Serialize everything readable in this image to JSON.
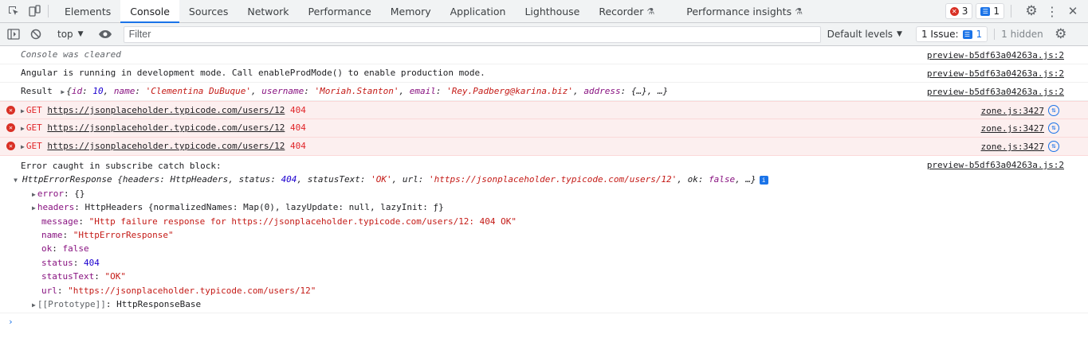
{
  "tabs": [
    "Elements",
    "Console",
    "Sources",
    "Network",
    "Performance",
    "Memory",
    "Application",
    "Lighthouse",
    "Recorder",
    "Performance insights"
  ],
  "active_tab": "Console",
  "badges": {
    "errors": "3",
    "messages": "1"
  },
  "toolbar": {
    "context": "top",
    "filter_placeholder": "Filter",
    "levels": "Default levels",
    "issues_label": "1 Issue:",
    "issues_count": "1",
    "hidden": "1 hidden"
  },
  "messages": {
    "cleared": "Console was cleared",
    "cleared_src": "preview-b5df63a04263a.js:2",
    "angular": "Angular is running in development mode. Call enableProdMode() to enable production mode.",
    "angular_src": "preview-b5df63a04263a.js:2",
    "result_label": "Result",
    "result_src": "preview-b5df63a04263a.js:2",
    "result_obj": {
      "id_key": "id",
      "id_val": "10",
      "name_key": "name",
      "name_val": "'Clementina DuBuque'",
      "username_key": "username",
      "username_val": "'Moriah.Stanton'",
      "email_key": "email",
      "email_val": "'Rey.Padberg@karina.biz'",
      "address_key": "address",
      "address_val": "{…}",
      "ellipsis": "…"
    },
    "errors": [
      {
        "method": "GET",
        "url": "https://jsonplaceholder.typicode.com/users/12",
        "code": "404",
        "src": "zone.js:3427"
      },
      {
        "method": "GET",
        "url": "https://jsonplaceholder.typicode.com/users/12",
        "code": "404",
        "src": "zone.js:3427"
      },
      {
        "method": "GET",
        "url": "https://jsonplaceholder.typicode.com/users/12",
        "code": "404",
        "src": "zone.js:3427"
      }
    ],
    "caught": "Error caught in subscribe catch block:",
    "caught_src": "preview-b5df63a04263a.js:2",
    "http_error": {
      "summary_name": "HttpErrorResponse",
      "summary_headers_key": "headers",
      "summary_headers_val": "HttpHeaders",
      "summary_status_key": "status",
      "summary_status_val": "404",
      "summary_statusText_key": "statusText",
      "summary_statusText_val": "'OK'",
      "summary_url_key": "url",
      "summary_url_val": "'https://jsonplaceholder.typicode.com/users/12'",
      "summary_ok_key": "ok",
      "summary_ok_val": "false",
      "error_key": "error",
      "error_val": "{}",
      "headers_key": "headers",
      "headers_val": "HttpHeaders {normalizedNames: Map(0), lazyUpdate: null, lazyInit: ƒ}",
      "message_key": "message",
      "message_val": "\"Http failure response for https://jsonplaceholder.typicode.com/users/12: 404 OK\"",
      "name_key": "name",
      "name_val": "\"HttpErrorResponse\"",
      "ok_key": "ok",
      "ok_val": "false",
      "status_key": "status",
      "status_val": "404",
      "statusText_key": "statusText",
      "statusText_val": "\"OK\"",
      "url_key": "url",
      "url_val": "\"https://jsonplaceholder.typicode.com/users/12\"",
      "proto_key": "[[Prototype]]",
      "proto_val": "HttpResponseBase"
    }
  }
}
